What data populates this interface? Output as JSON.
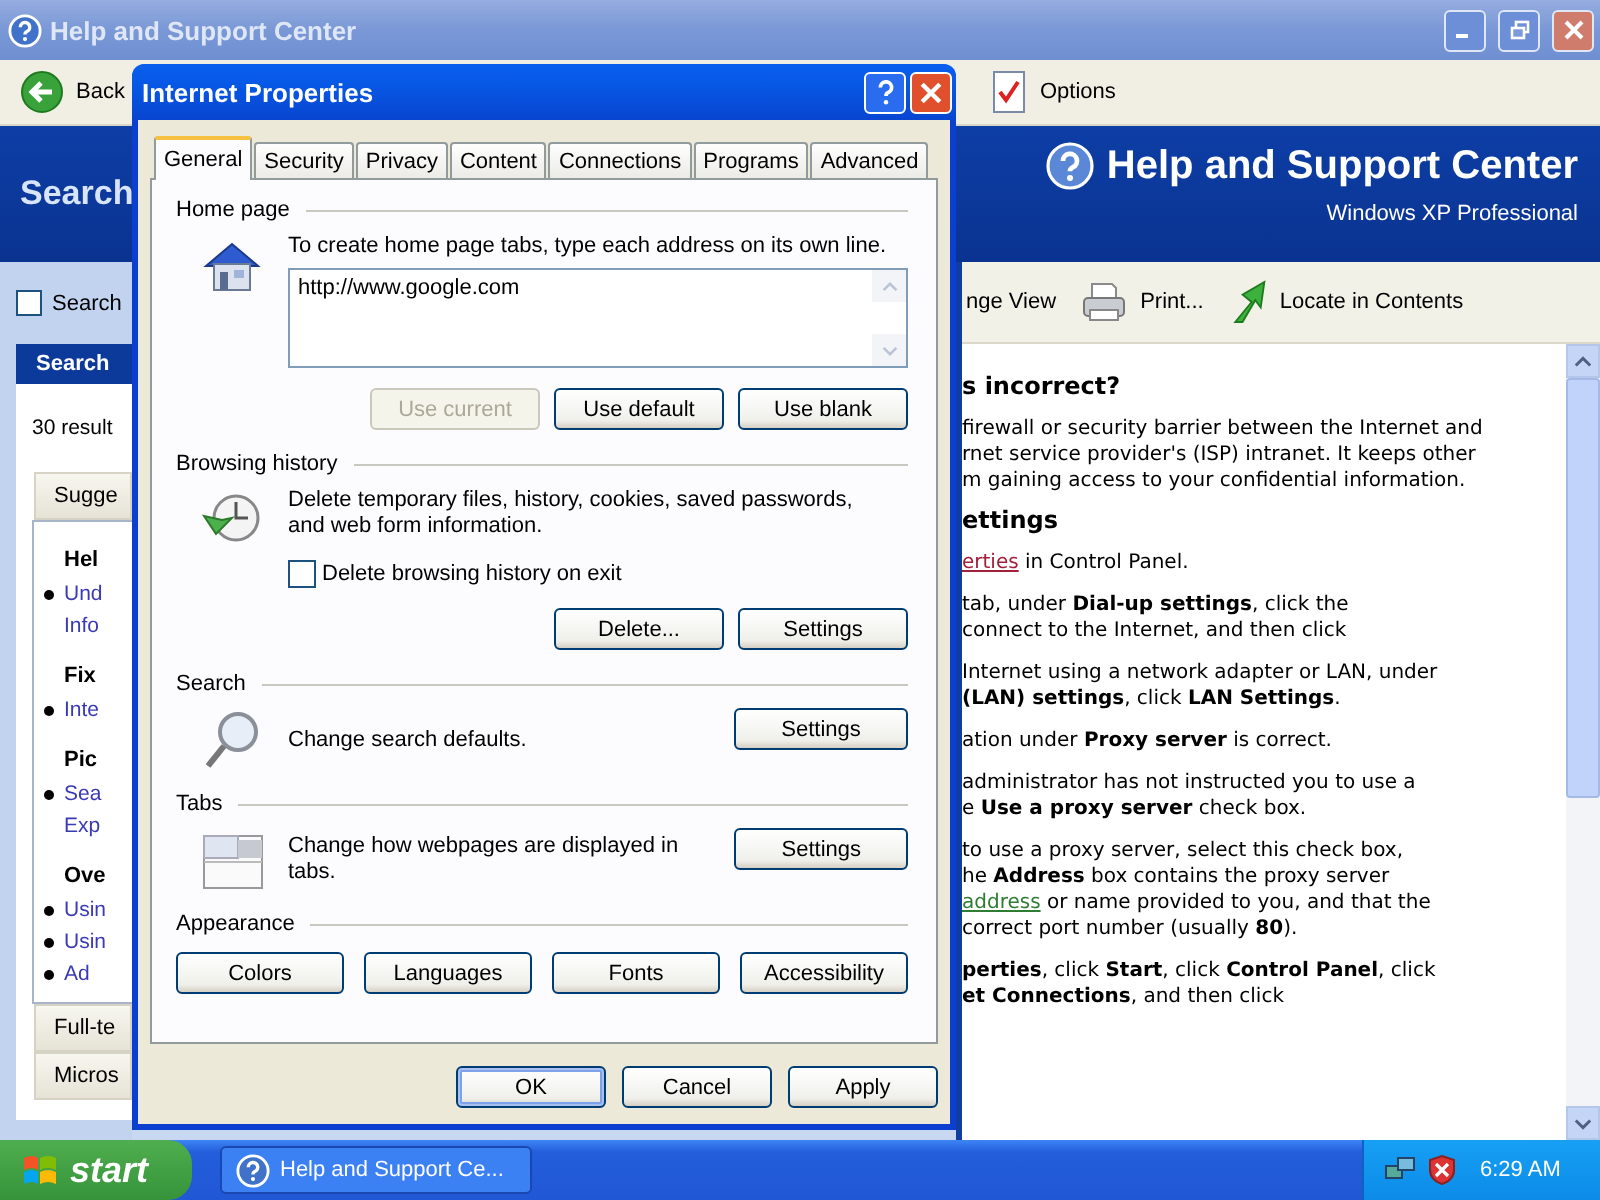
{
  "window": {
    "title": "Help and Support Center"
  },
  "toolbar": {
    "back": "Back",
    "options": "Options",
    "change_view": "nge View",
    "print": "Print...",
    "locate": "Locate in Contents"
  },
  "header": {
    "left": "Search",
    "title": "Help and Support Center",
    "subtitle": "Windows XP Professional"
  },
  "sidebar": {
    "search_check": {
      "label": "Search",
      "checked": false
    },
    "results_title": "Search",
    "results_count": "30 result",
    "open_section": "Sugge",
    "items": [
      {
        "kind": "heading",
        "text": "Hel"
      },
      {
        "kind": "bullet",
        "text": "Und"
      },
      {
        "kind": "continuation",
        "text": "Info"
      },
      {
        "kind": "heading",
        "text": "Fix"
      },
      {
        "kind": "bullet",
        "text": "Inte"
      },
      {
        "kind": "heading",
        "text": "Pic"
      },
      {
        "kind": "bullet",
        "text": "Sea"
      },
      {
        "kind": "continuation",
        "text": "Exp"
      },
      {
        "kind": "heading",
        "text": "Ove"
      },
      {
        "kind": "bullet",
        "text": "Usin"
      },
      {
        "kind": "bullet",
        "text": "Usin"
      },
      {
        "kind": "bullet",
        "text": "Ad"
      }
    ],
    "sections": [
      "Full-te",
      "Micros"
    ]
  },
  "content": [
    {
      "kind": "heading",
      "lines": [
        "s incorrect?"
      ]
    },
    {
      "kind": "text",
      "lines": [
        "firewall or security barrier between the Internet and",
        "rnet service provider's (ISP) intranet. It keeps other",
        "m gaining access to your confidential information."
      ]
    },
    {
      "kind": "heading",
      "lines": [
        "ettings"
      ]
    },
    {
      "kind": "text",
      "lines": [
        {
          "link": "erties",
          "visited": true,
          "text": " in Control Panel."
        }
      ]
    },
    {
      "kind": "text",
      "lines": [
        "tab, under **Dial-up settings**, click the",
        "connect to the Internet, and then click"
      ]
    },
    {
      "kind": "text",
      "lines": [
        "Internet using a network adapter or LAN, under",
        "**(LAN) settings**, click **LAN Settings**."
      ]
    },
    {
      "kind": "text",
      "lines": [
        "ation under **Proxy server** is correct."
      ]
    },
    {
      "kind": "text",
      "lines": [
        "administrator has not instructed you to use a",
        "e **Use a proxy server** check box."
      ]
    },
    {
      "kind": "text",
      "lines": [
        "to use a proxy server, select this check box,",
        "he **Address** box contains the proxy server",
        {
          "link": "address",
          "visited": false,
          "text": " or name provided to you, and that the"
        },
        "correct port number (usually **80**)."
      ]
    },
    {
      "kind": "text",
      "lines": [
        "**perties**, click **Start**, click **Control Panel**, click",
        "**et Connections**, and then click"
      ]
    }
  ],
  "dialog": {
    "title": "Internet Properties",
    "tabs": [
      {
        "label": "General",
        "selected": true
      },
      {
        "label": "Security",
        "selected": false
      },
      {
        "label": "Privacy",
        "selected": false
      },
      {
        "label": "Content",
        "selected": false
      },
      {
        "label": "Connections",
        "selected": false
      },
      {
        "label": "Programs",
        "selected": false
      },
      {
        "label": "Advanced",
        "selected": false
      }
    ],
    "home_page": {
      "label": "Home page",
      "description": "To create home page tabs, type each address on its own line.",
      "value": "http://www.google.com",
      "buttons": [
        {
          "label": "Use current",
          "disabled": true
        },
        {
          "label": "Use default",
          "disabled": false
        },
        {
          "label": "Use blank",
          "disabled": false
        }
      ]
    },
    "browsing_history": {
      "label": "Browsing history",
      "description": "Delete temporary files, history, cookies, saved passwords, and web form information.",
      "checkbox": {
        "label": "Delete browsing history on exit",
        "checked": false
      },
      "buttons": [
        {
          "label": "Delete...",
          "disabled": false
        },
        {
          "label": "Settings",
          "disabled": false
        }
      ]
    },
    "search": {
      "label": "Search",
      "description": "Change search defaults.",
      "button": "Settings"
    },
    "tabs_group": {
      "label": "Tabs",
      "description": "Change how webpages are displayed in tabs.",
      "button": "Settings"
    },
    "appearance": {
      "label": "Appearance",
      "buttons": [
        "Colors",
        "Languages",
        "Fonts",
        "Accessibility"
      ]
    },
    "footer_buttons": [
      {
        "label": "OK",
        "default": true
      },
      {
        "label": "Cancel",
        "default": false
      },
      {
        "label": "Apply",
        "default": false
      }
    ]
  },
  "taskbar": {
    "start": "start",
    "task": "Help and Support Ce...",
    "clock": "6:29 AM"
  }
}
